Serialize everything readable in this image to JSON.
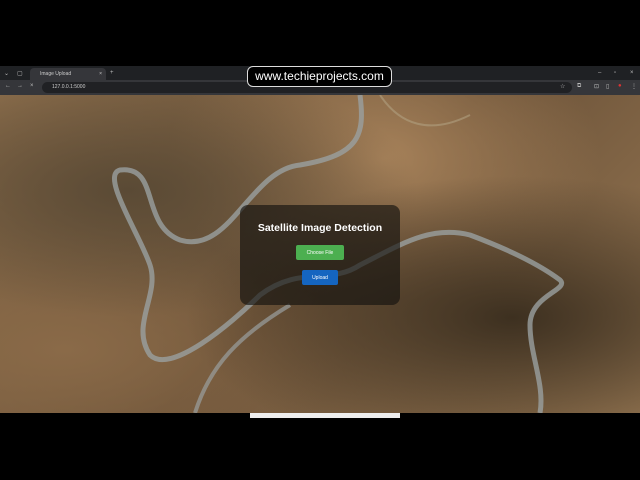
{
  "browser": {
    "tab_title": "Image Upload",
    "new_tab": "+",
    "url": "127.0.0.1:5000",
    "window_controls": [
      "–",
      "▫",
      "×"
    ]
  },
  "watermark": "www.techieprojects.com",
  "page": {
    "title": "Satellite Image Detection",
    "choose_label": "Choose File",
    "upload_label": "Upload"
  }
}
